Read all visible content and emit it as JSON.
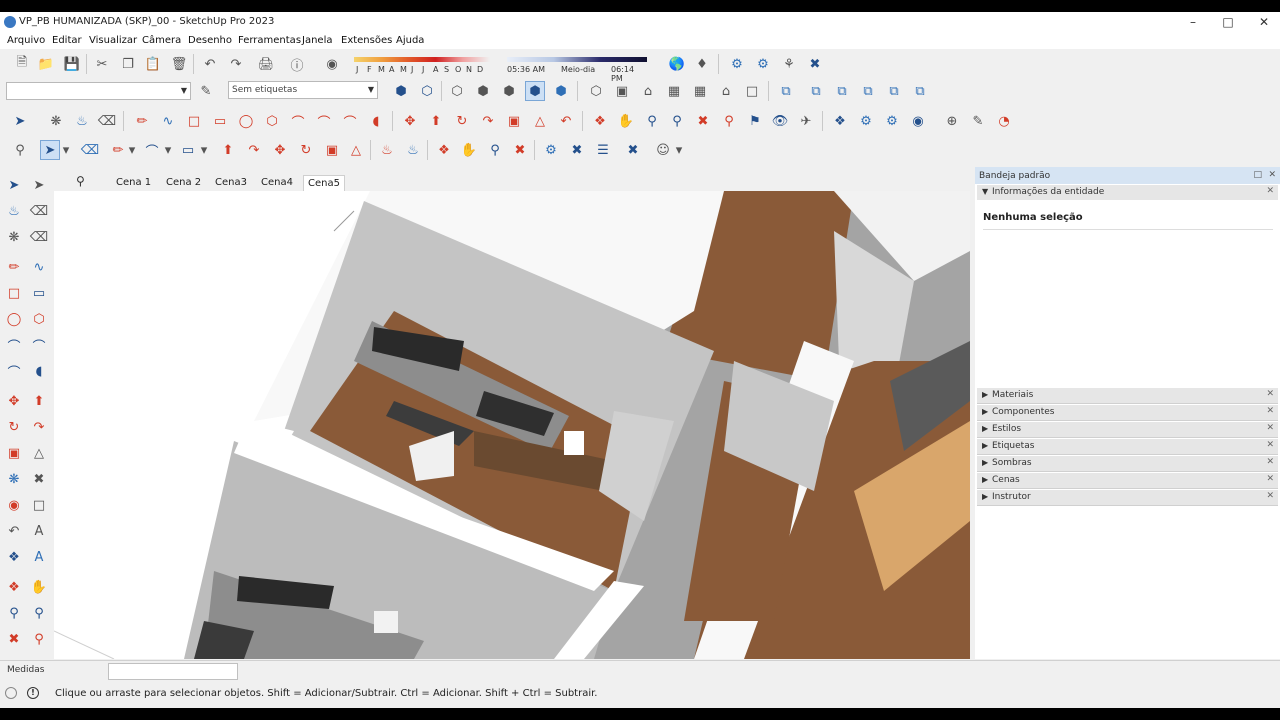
{
  "window": {
    "title": "VP_PB HUMANIZADA (SKP)_00 - SketchUp Pro 2023"
  },
  "menu": [
    "Arquivo",
    "Editar",
    "Visualizar",
    "Câmera",
    "Desenho",
    "Ferramentas",
    "Janela",
    "Extensões",
    "Ajuda"
  ],
  "toolbar": {
    "layer_dropdown": "",
    "tag_dropdown": "Sem etiquetas",
    "months": [
      "J",
      "F",
      "M",
      "A",
      "M",
      "J",
      "J",
      "A",
      "S",
      "O",
      "N",
      "D"
    ],
    "time_start": "05:36 AM",
    "time_mid": "Meio-dia",
    "time_end": "06:14 PM"
  },
  "scenes": [
    "Cena 1",
    "Cena 2",
    "Cena3",
    "Cena4",
    "Cena5"
  ],
  "active_scene": "Cena5",
  "tray": {
    "title": "Bandeja padrão",
    "entity_panel": "Informações da entidade",
    "entity_value": "Nenhuma seleção",
    "panels": [
      "Materiais",
      "Componentes",
      "Estilos",
      "Etiquetas",
      "Sombras",
      "Cenas",
      "Instrutor"
    ]
  },
  "measurements": {
    "label": "Medidas",
    "value": ""
  },
  "status": {
    "text": "Clique ou arraste para selecionar objetos. Shift = Adicionar/Subtrair. Ctrl = Adicionar. Shift + Ctrl = Subtrair."
  },
  "colors": {
    "accent_red": "#d23c28",
    "accent_blue": "#2f6fb6",
    "floor_wood": "#8a5a38",
    "wall_grey": "#bdbdbd"
  }
}
